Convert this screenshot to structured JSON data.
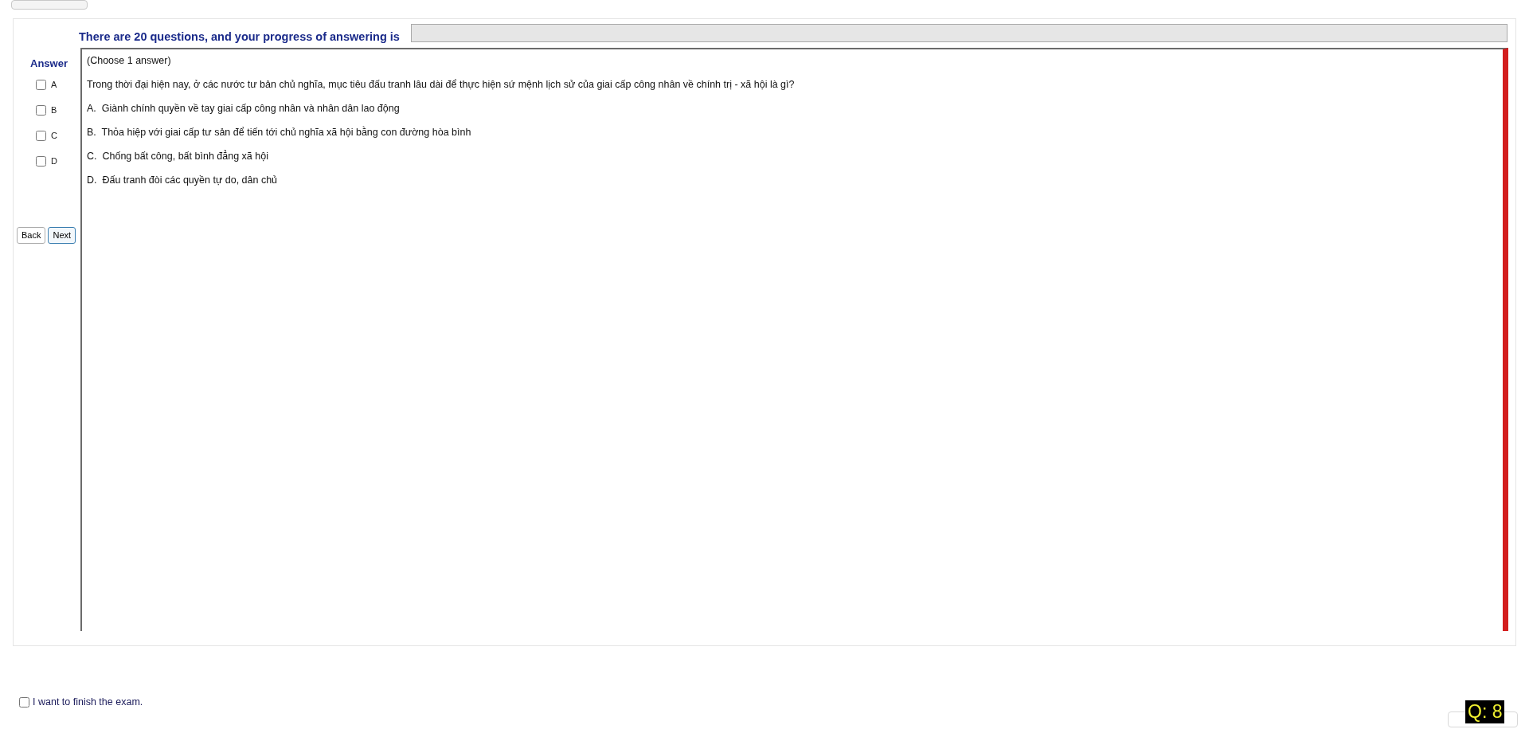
{
  "progress": {
    "title": "There are 20 questions, and your progress of answering is",
    "level": 0
  },
  "answer_panel": {
    "heading": "Answer",
    "options": [
      {
        "label": "A",
        "checked": false
      },
      {
        "label": "B",
        "checked": false
      },
      {
        "label": "C",
        "checked": false
      },
      {
        "label": "D",
        "checked": false
      }
    ]
  },
  "buttons": [
    {
      "label": "Back",
      "selected": false
    },
    {
      "label": "Next",
      "selected": true
    }
  ],
  "question": {
    "instruction": "(Choose 1 answer)",
    "text": "Trong thời đại hiện nay, ở các nước tư bản chủ nghĩa, mục tiêu đấu tranh lâu dài để thực hiện sứ mệnh lịch sử của giai cấp công nhân về chính trị - xã hội là gì?",
    "choices": [
      "A.  Giành chính quyền về tay giai cấp công nhân và nhân dân lao động",
      "B.  Thỏa hiệp với giai cấp tư sản để tiến tới chủ nghĩa xã hội bằng con đường hòa bình",
      "C.  Chống bất công, bất bình đẳng xã hội",
      "D.  Đấu tranh đòi các quyền tự do, dân chủ"
    ]
  },
  "finish": {
    "label": "I want to finish the exam.",
    "checked": false
  },
  "question_counter": "Q: 8"
}
